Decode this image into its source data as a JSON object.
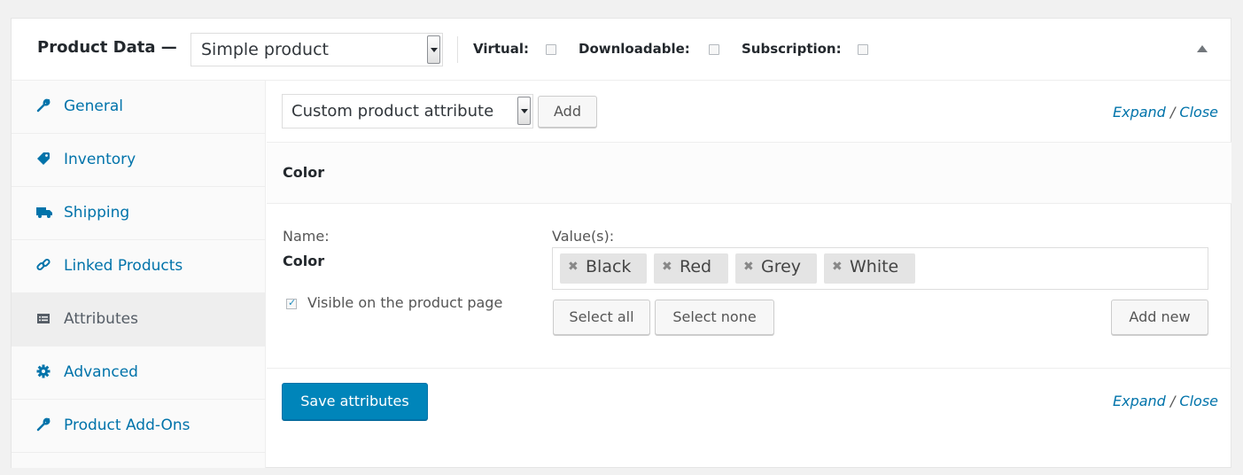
{
  "header": {
    "title": "Product Data —",
    "product_type": "Simple product",
    "options": [
      {
        "label": "Virtual:",
        "checked": false
      },
      {
        "label": "Downloadable:",
        "checked": false
      },
      {
        "label": "Subscription:",
        "checked": false
      }
    ]
  },
  "sidebar": {
    "tabs": [
      {
        "label": "General",
        "icon": "wrench-icon",
        "active": false
      },
      {
        "label": "Inventory",
        "icon": "tag-icon",
        "active": false
      },
      {
        "label": "Shipping",
        "icon": "truck-icon",
        "active": false
      },
      {
        "label": "Linked Products",
        "icon": "link-icon",
        "active": false
      },
      {
        "label": "Attributes",
        "icon": "list-icon",
        "active": true
      },
      {
        "label": "Advanced",
        "icon": "gear-icon",
        "active": false
      },
      {
        "label": "Product Add-Ons",
        "icon": "wrench-icon",
        "active": false
      }
    ]
  },
  "attributes": {
    "select_value": "Custom product attribute",
    "add_label": "Add",
    "expand_label": "Expand",
    "slash": "/",
    "close_label": "Close",
    "attribute_title": "Color",
    "name_label": "Name:",
    "name_value": "Color",
    "values_label": "Value(s):",
    "values": [
      "Black",
      "Red",
      "Grey",
      "White"
    ],
    "visible_label": "Visible on the product page",
    "visible_checked": true,
    "select_all_label": "Select all",
    "select_none_label": "Select none",
    "add_new_label": "Add new",
    "save_label": "Save attributes"
  },
  "colors": {
    "link": "#0073aa",
    "primary_button": "#0085ba",
    "active_tab_bg": "#eeeeee"
  }
}
